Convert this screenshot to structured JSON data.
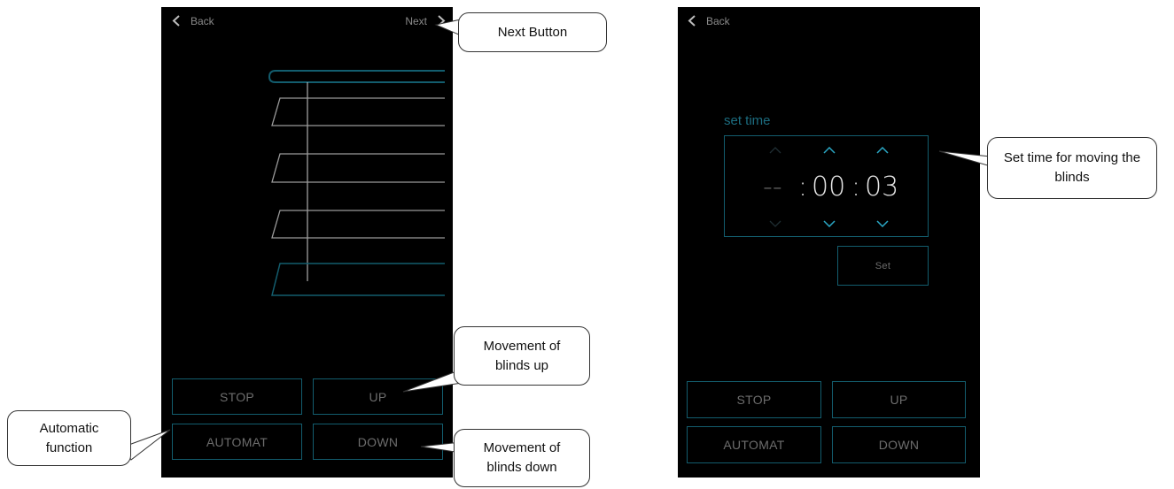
{
  "screen1": {
    "back_label": "Back",
    "next_label": "Next",
    "buttons": {
      "stop": "STOP",
      "up": "UP",
      "automat": "AUTOMAT",
      "down": "DOWN"
    }
  },
  "screen2": {
    "back_label": "Back",
    "set_time_label": "set time",
    "time": {
      "hours": "--",
      "sep1": ":",
      "minutes": "00",
      "sep2": ":",
      "seconds": "03"
    },
    "set_label": "Set",
    "buttons": {
      "stop": "STOP",
      "up": "UP",
      "automat": "AUTOMAT",
      "down": "DOWN"
    }
  },
  "callouts": {
    "next_button": "Next Button",
    "blinds_up": "Movement of blinds up",
    "automatic": "Automatic function",
    "blinds_down": "Movement of blinds down",
    "set_time": "Set time for moving the blinds"
  },
  "colors": {
    "screen_bg": "#000000",
    "accent_border": "#135d6e",
    "accent_text": "#1c6d80",
    "button_text": "#6d6d6d"
  }
}
